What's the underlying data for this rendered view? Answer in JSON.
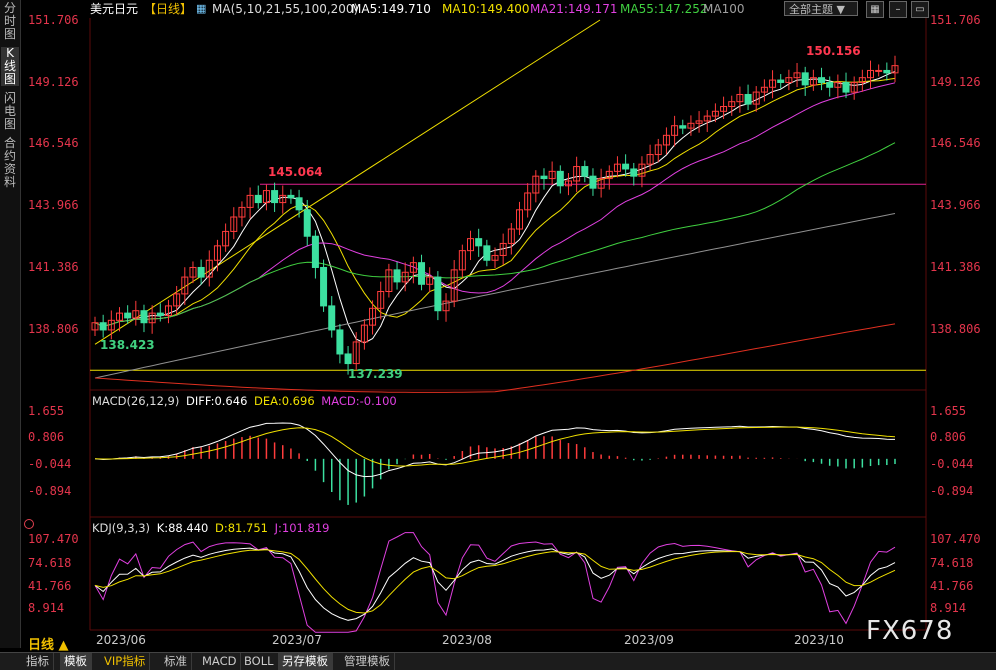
{
  "sidebar": {
    "tabs": [
      {
        "label": "分时图",
        "active": false
      },
      {
        "label": "K线图",
        "active": true
      },
      {
        "label": "闪电图",
        "active": false
      },
      {
        "label": "合约资料",
        "active": false
      }
    ]
  },
  "header": {
    "symbol": "美元日元",
    "period": "【日线】",
    "ma_params": "MA(5,10,21,55,100,200)",
    "ma5": "MA5:149.710",
    "ma10": "MA10:149.400",
    "ma21": "MA21:149.171",
    "ma55": "MA55:147.252",
    "ma100": "MA100",
    "theme_select": "全部主题",
    "colors": {
      "ma5": "#ffffff",
      "ma10": "#f0e000",
      "ma21": "#e040e0",
      "ma55": "#40d040",
      "ma100": "#a0a0a0",
      "ma200": "#e03020"
    }
  },
  "price_axis": {
    "labels": [
      "151.706",
      "149.126",
      "146.546",
      "143.966",
      "141.386",
      "138.806"
    ]
  },
  "annotations": {
    "high_recent": "150.156",
    "high_mid": "145.064",
    "low_start": "138.423",
    "low_mid": "137.239"
  },
  "macd": {
    "title": "MACD(26,12,9)",
    "diff": "DIFF:0.646",
    "dea": "DEA:0.696",
    "macd": "MACD:-0.100",
    "axis": [
      "1.655",
      "0.806",
      "-0.044",
      "-0.894"
    ]
  },
  "kdj": {
    "title": "KDJ(9,3,3)",
    "k": "K:88.440",
    "d": "D:81.751",
    "j": "J:101.819",
    "axis": [
      "107.470",
      "74.618",
      "41.766",
      "8.914"
    ]
  },
  "time_axis": {
    "months": [
      "2023/06",
      "2023/07",
      "2023/08",
      "2023/09",
      "2023/10"
    ]
  },
  "period_button": "日线 ▲",
  "watermark": "FX678",
  "bottom_tabs": [
    {
      "label": "指标",
      "active": false
    },
    {
      "label": "模板",
      "active": true
    },
    {
      "label": "VIP指标",
      "active": false
    },
    {
      "label": "标准",
      "active": false
    },
    {
      "label": "MACD",
      "active": false
    },
    {
      "label": "BOLL",
      "active": false
    },
    {
      "label": "另存模板",
      "active": true
    },
    {
      "label": "管理模板",
      "active": false
    }
  ],
  "chart_data": [
    {
      "type": "candlestick",
      "title": "美元日元【日线】",
      "ylim": [
        136.5,
        151.9
      ],
      "x": [
        "2023/06",
        "2023/07",
        "2023/08",
        "2023/09",
        "2023/10"
      ],
      "close_series": [
        139.3,
        139.0,
        139.4,
        139.7,
        139.5,
        139.8,
        139.3,
        139.7,
        139.6,
        140.0,
        140.5,
        141.2,
        141.6,
        141.2,
        141.9,
        142.5,
        143.1,
        143.7,
        144.1,
        144.6,
        144.3,
        144.8,
        144.3,
        144.6,
        144.5,
        144.0,
        142.9,
        141.6,
        140.0,
        139.0,
        138.0,
        137.6,
        138.5,
        139.2,
        139.9,
        140.6,
        141.5,
        141.0,
        141.4,
        141.8,
        140.9,
        141.2,
        139.8,
        140.2,
        141.5,
        142.3,
        142.8,
        142.5,
        141.9,
        142.1,
        142.6,
        143.2,
        144.0,
        144.7,
        145.4,
        145.3,
        145.6,
        145.0,
        145.2,
        145.8,
        145.4,
        144.9,
        145.3,
        145.6,
        145.9,
        145.7,
        145.4,
        145.9,
        146.3,
        146.7,
        147.1,
        147.5,
        147.4,
        147.6,
        147.7,
        147.9,
        148.1,
        148.3,
        148.5,
        148.8,
        148.4,
        148.9,
        149.1,
        149.4,
        149.3,
        149.5,
        149.7,
        149.2,
        149.5,
        149.3,
        149.1,
        149.3,
        148.9,
        149.3,
        149.5,
        149.8,
        149.8,
        149.7,
        150.0
      ],
      "annotations": [
        "150.156",
        "145.064",
        "138.423",
        "137.239"
      ],
      "series": [
        {
          "name": "MA5",
          "value": 149.71
        },
        {
          "name": "MA10",
          "value": 149.4
        },
        {
          "name": "MA21",
          "value": 149.171
        },
        {
          "name": "MA55",
          "value": 147.252
        },
        {
          "name": "MA100"
        }
      ]
    },
    {
      "type": "bar",
      "title": "MACD(26,12,9)",
      "ylim": [
        -2.1,
        2.2
      ],
      "series": [
        {
          "name": "DIFF",
          "value": 0.646
        },
        {
          "name": "DEA",
          "value": 0.696
        },
        {
          "name": "MACD",
          "value": -0.1
        }
      ]
    },
    {
      "type": "line",
      "title": "KDJ(9,3,3)",
      "ylim": [
        0,
        115
      ],
      "series": [
        {
          "name": "K",
          "value": 88.44
        },
        {
          "name": "D",
          "value": 81.751
        },
        {
          "name": "J",
          "value": 101.819
        }
      ]
    }
  ]
}
